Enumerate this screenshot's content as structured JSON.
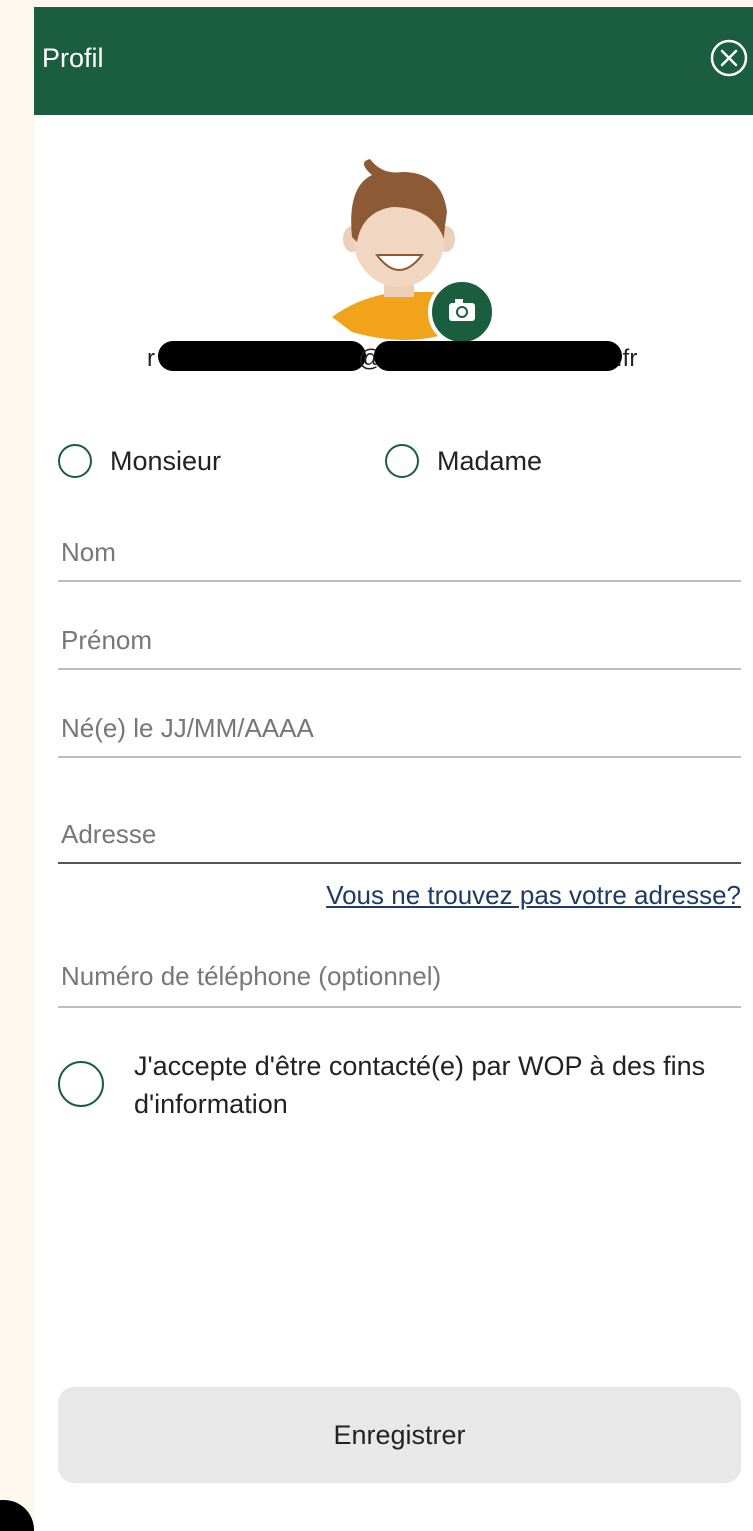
{
  "header": {
    "title": "Profil"
  },
  "profile": {
    "email_prefix": "r",
    "email_at": "@",
    "email_suffix": ".fr"
  },
  "civility": {
    "option_mr": "Monsieur",
    "option_mrs": "Madame"
  },
  "fields": {
    "nom_placeholder": "Nom",
    "prenom_placeholder": "Prénom",
    "naissance_placeholder": "Né(e) le JJ/MM/AAAA",
    "adresse_placeholder": "Adresse",
    "adresse_link": "Vous ne trouvez pas votre adresse?",
    "telephone_placeholder": "Numéro de téléphone (optionnel)"
  },
  "consent": {
    "text": "J'accepte d'être contacté(e) par WOP à des fins d'information"
  },
  "actions": {
    "save_label": "Enregistrer"
  },
  "colors": {
    "brand_green": "#1b5e3f",
    "avatar_shirt": "#f0a31b",
    "button_bg": "#e8e8e8",
    "link": "#1d3b66"
  }
}
